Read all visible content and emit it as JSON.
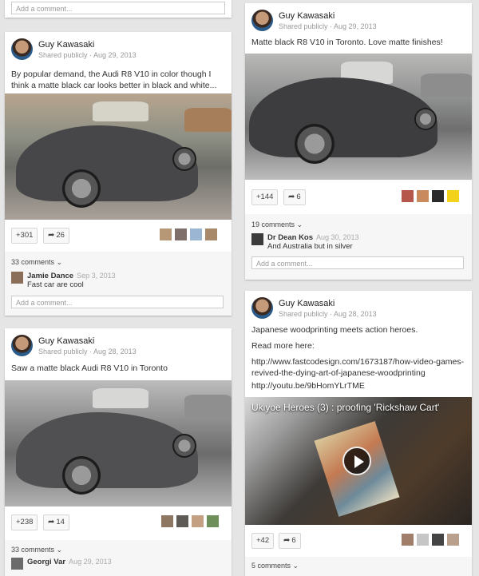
{
  "colors": {
    "page_background": "#e5e5e5",
    "card": "#ffffff",
    "accent_yellow": "#f2d21a"
  },
  "top_fragment": {
    "add_comment_placeholder": "Add a comment..."
  },
  "posts": [
    {
      "author": "Guy Kawasaki",
      "meta": "Shared publicly  ·  Aug 29, 2013",
      "text": "By popular demand, the Audi R8 V10 in color though I think a matte black car looks better in black and white...",
      "plus_count": "+301",
      "share_count": "26",
      "comments_count": "33 comments ⌄",
      "comments": [
        {
          "name": "Jamie Dance",
          "date": "Sep 3, 2013",
          "text": "Fast car are cool"
        }
      ],
      "add_comment_placeholder": "Add a comment..."
    },
    {
      "author": "Guy Kawasaki",
      "meta": "Shared publicly  ·  Aug 29, 2013",
      "text": "Matte black R8 V10 in Toronto. Love matte finishes!",
      "plus_count": "+144",
      "share_count": "6",
      "comments_count": "19 comments ⌄",
      "comments": [
        {
          "name": "Dr Dean Kos",
          "date": "Aug 30, 2013",
          "text": "And Australia but in silver"
        }
      ],
      "add_comment_placeholder": "Add a comment..."
    },
    {
      "author": "Guy Kawasaki",
      "meta": "Shared publicly  ·  Aug 28, 2013",
      "text": "Saw a matte black Audi R8 V10 in Toronto",
      "plus_count": "+238",
      "share_count": "14",
      "comments_count": "33 comments ⌄",
      "comments": [
        {
          "name": "Georgi Var",
          "date": "Aug 29, 2013",
          "text": ""
        }
      ]
    },
    {
      "author": "Guy Kawasaki",
      "meta": "Shared publicly  ·  Aug 28, 2013",
      "text": "Japanese woodprinting meets action heroes.",
      "read_more": "Read more here:",
      "link1": "http://www.fastcodesign.com/1673187/how-video-games-revived-the-dying-art-of-japanese-woodprinting",
      "link2": "http://youtu.be/9bHomYLrTME",
      "video_title": "Ukiyoe Heroes (3) : proofing 'Rickshaw Cart'",
      "plus_count": "+42",
      "share_count": "6",
      "comments_count": "5 comments ⌄"
    }
  ],
  "icons": {
    "plus": "plus-one-icon",
    "share": "share-arrow-icon",
    "play": "play-icon",
    "chevron": "chevron-down-icon"
  }
}
